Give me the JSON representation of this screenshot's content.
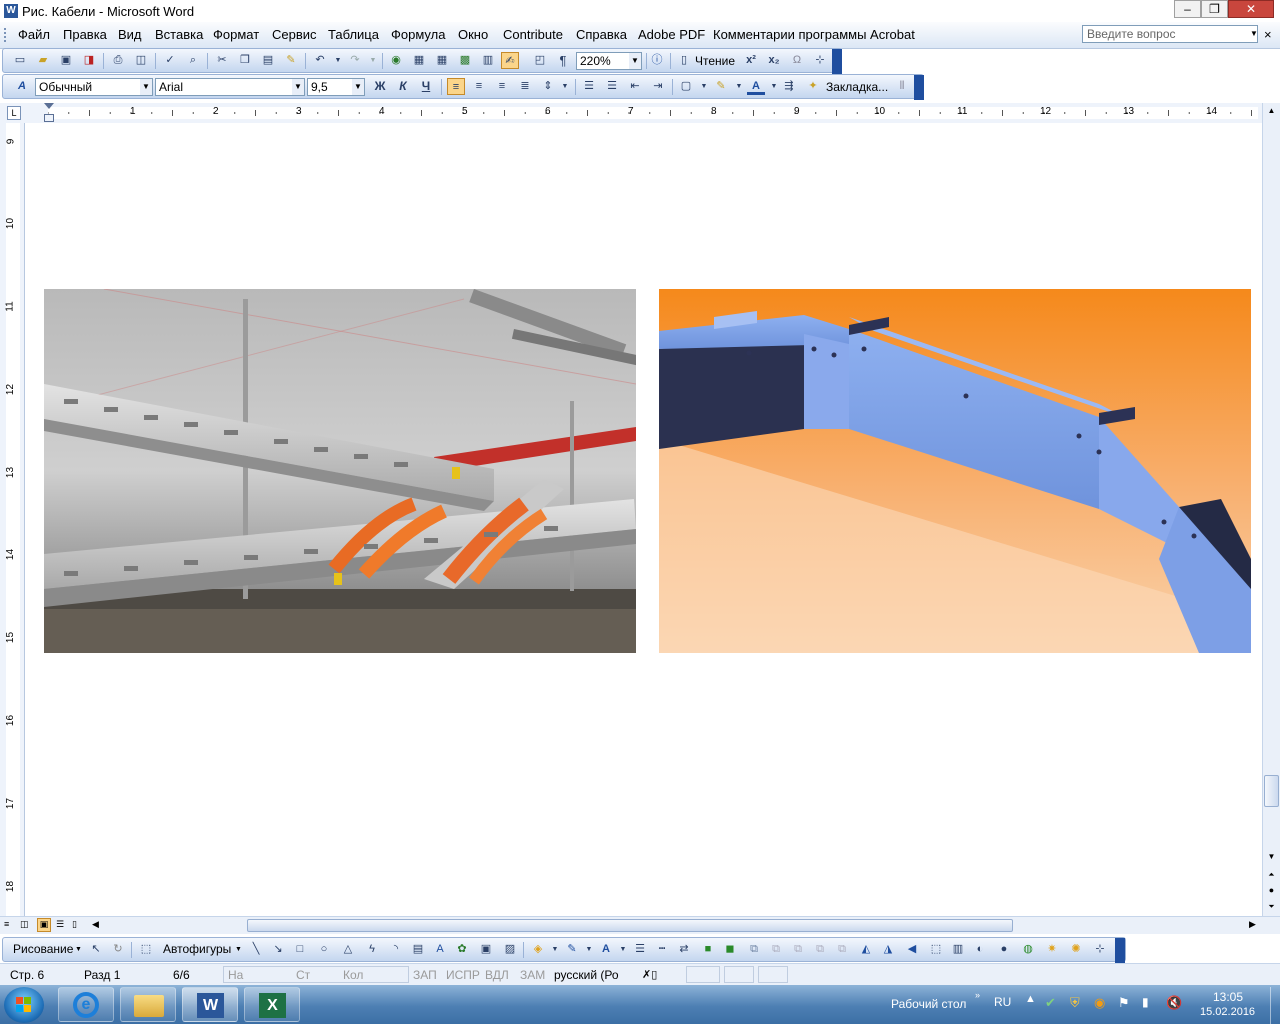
{
  "window": {
    "title": "Рис. Кабели - Microsoft Word",
    "minimize": "–",
    "restore": "❐",
    "close": "✕"
  },
  "menu": {
    "items": [
      "Файл",
      "Правка",
      "Вид",
      "Вставка",
      "Формат",
      "Сервис",
      "Таблица",
      "Формула",
      "Окно",
      "Contribute",
      "Справка",
      "Adobe PDF",
      "Комментарии программы Acrobat"
    ],
    "help_placeholder": "Введите вопрос",
    "close_doc": "×"
  },
  "standard_toolbar": {
    "zoom": "220%",
    "reading_label": "Чтение"
  },
  "format_toolbar": {
    "style": "Обычный",
    "font": "Arial",
    "size": "9,5",
    "bold": "Ж",
    "italic": "К",
    "underline": "Ч",
    "bookmark_label": "Закладка..."
  },
  "ruler": {
    "h_numbers": [
      "1",
      "2",
      "3",
      "4",
      "5",
      "6",
      "7",
      "8",
      "9",
      "10",
      "11",
      "12",
      "13",
      "14"
    ],
    "v_numbers": [
      "9",
      "10",
      "11",
      "12",
      "13",
      "14",
      "15",
      "16",
      "17",
      "18"
    ]
  },
  "drawing_toolbar": {
    "draw_label": "Рисование",
    "autoshapes_label": "Автофигуры"
  },
  "status": {
    "page": "Стр. 6",
    "section": "Разд 1",
    "pages": "6/6",
    "at": "На",
    "line": "Ст",
    "col": "Кол",
    "rec": "ЗАП",
    "trk": "ИСПР",
    "ext": "ВДЛ",
    "ovr": "ЗАМ",
    "language": "русский (Ро"
  },
  "taskbar": {
    "desktop_label": "Рабочий стол",
    "lang": "RU",
    "time": "13:05",
    "date": "15.02.2016"
  },
  "colors": {
    "toolbar_blue": "#c4d6ef",
    "orange_bg": "#f7941d",
    "duct_blue": "#7fa2e6"
  }
}
